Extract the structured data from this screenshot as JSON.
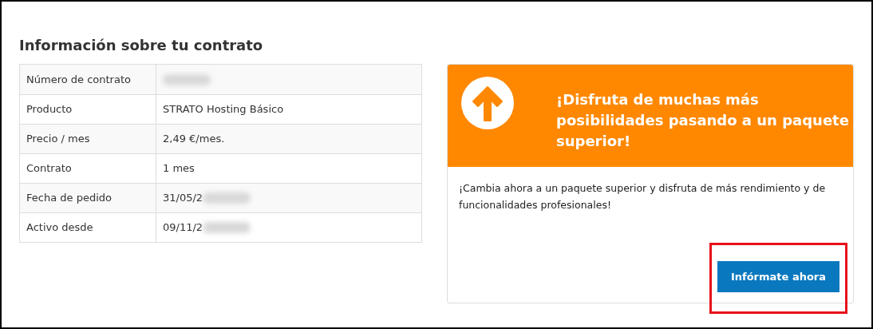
{
  "section_title": "Información sobre tu contrato",
  "contract_table": {
    "rows": [
      {
        "label": "Número de contrato",
        "redacted": true
      },
      {
        "label": "Producto",
        "value": "STRATO Hosting Básico",
        "redacted": false
      },
      {
        "label": "Precio / mes",
        "value": "2,49 €/mes.",
        "redacted": false
      },
      {
        "label": "Contrato",
        "value": "1 mes",
        "redacted": false
      },
      {
        "label": "Fecha de pedido",
        "value": "31/05/2",
        "redacted": true
      },
      {
        "label": "Activo desde",
        "value": "09/11/2",
        "redacted": true
      }
    ]
  },
  "upgrade_card": {
    "heading": "¡Disfruta de muchas más posibilidades pasando a un paquete superior!",
    "body": "¡Cambia ahora a un paquete superior y disfruta de más rendimiento y de funcionalidades profesionales!",
    "button": {
      "label": "Infórmate ahora",
      "highlighted": true
    }
  }
}
